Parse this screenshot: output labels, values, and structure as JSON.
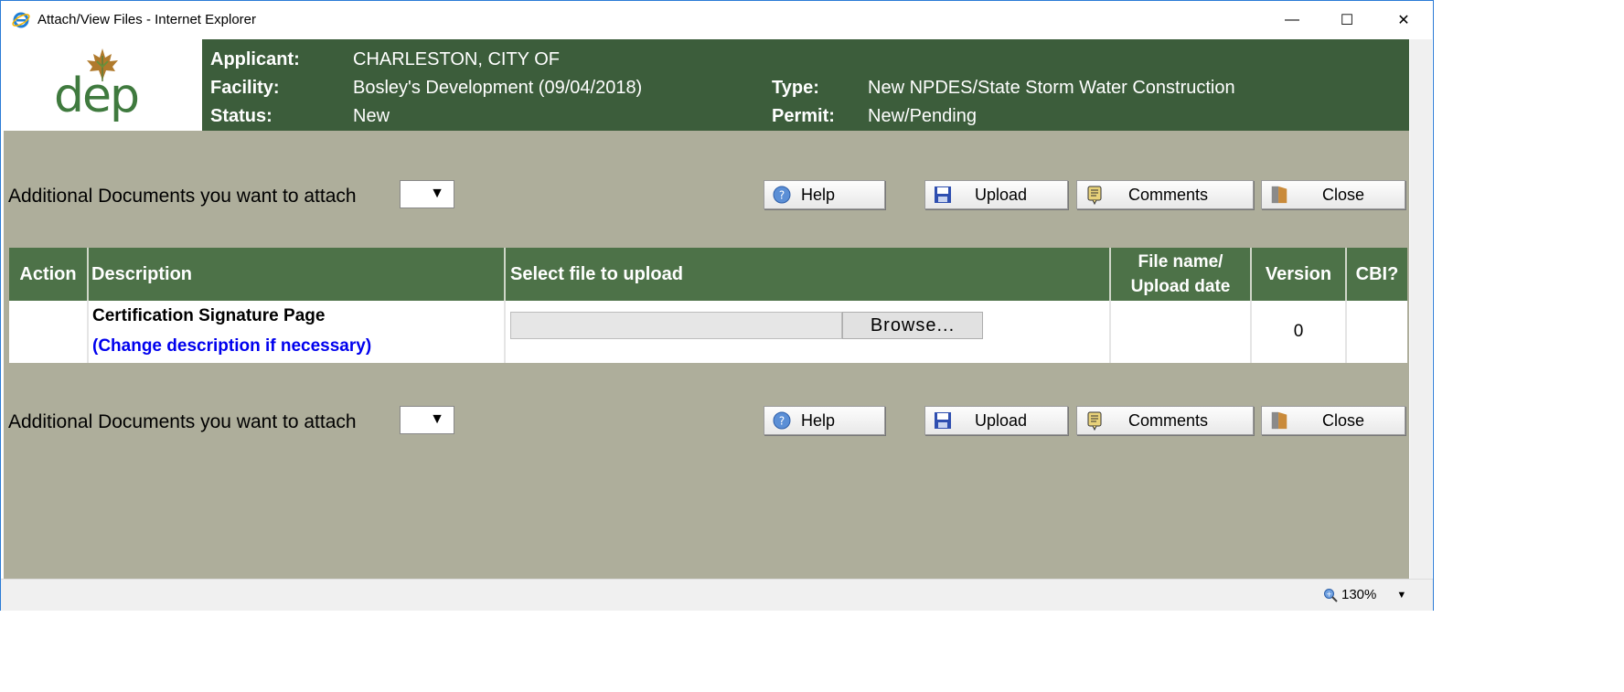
{
  "window": {
    "title": "Attach/View Files - Internet Explorer",
    "minimize": "—",
    "maximize": "☐",
    "close": "✕"
  },
  "header": {
    "logo_text": "dep",
    "applicant_label": "Applicant:",
    "applicant_value": "CHARLESTON, CITY OF",
    "facility_label": "Facility:",
    "facility_value": "Bosley's Development (09/04/2018)",
    "status_label": "Status:",
    "status_value": "New",
    "type_label": "Type:",
    "type_value": "New NPDES/State Storm Water Construction",
    "permit_label": "Permit:",
    "permit_value": "New/Pending"
  },
  "toolbar": {
    "attach_label": "Additional Documents you want to attach",
    "attach_selected": "",
    "help_label": "Help",
    "upload_label": "Upload",
    "comments_label": "Comments",
    "close_label": "Close"
  },
  "table": {
    "headers": {
      "action": "Action",
      "description": "Description",
      "select_file": "Select file to upload",
      "file_name_line1": "File name/",
      "file_name_line2": "Upload date",
      "version": "Version",
      "cbi": "CBI?"
    },
    "rows": [
      {
        "action": "",
        "description": "Certification Signature Page",
        "change_link": "(Change description if necessary)",
        "browse_label": "Browse...",
        "file_name": "",
        "version": "0",
        "cbi": ""
      }
    ]
  },
  "statusbar": {
    "zoom": "130%"
  },
  "colors": {
    "header_bg": "#3c5d3b",
    "table_header_bg": "#4d7248",
    "content_bg": "#aeae9b",
    "link": "#0000ee"
  }
}
